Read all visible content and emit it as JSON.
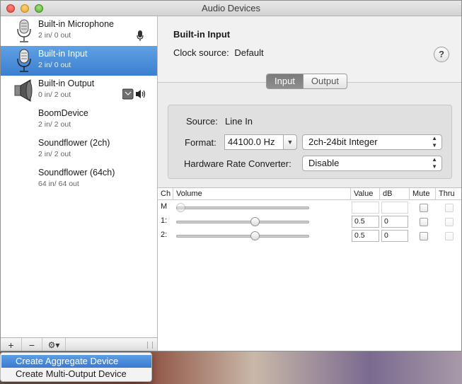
{
  "window": {
    "title": "Audio Devices"
  },
  "sidebar": {
    "devices": [
      {
        "name": "Built-in Microphone",
        "io": "2 in/ 0 out",
        "icon": "microphone-icon",
        "badge": "microphone-small-icon",
        "selected": false
      },
      {
        "name": "Built-in Input",
        "io": "2 in/ 0 out",
        "icon": "microphone-icon",
        "selected": true
      },
      {
        "name": "Built-in Output",
        "io": "0 in/ 2 out",
        "icon": "speaker-icon",
        "badge": "finder-speaker-icon",
        "selected": false
      },
      {
        "name": "BoomDevice",
        "io": "2 in/ 2 out",
        "selected": false
      },
      {
        "name": "Soundflower (2ch)",
        "io": "2 in/ 2 out",
        "selected": false
      },
      {
        "name": "Soundflower (64ch)",
        "io": "64 in/ 64 out",
        "selected": false
      }
    ],
    "add_label": "+",
    "remove_label": "−",
    "gear_label": "⚙▾"
  },
  "main": {
    "device_title": "Built-in Input",
    "clock_label": "Clock source:",
    "clock_value": "Default",
    "help_label": "?",
    "tabs": [
      {
        "label": "Input",
        "active": true
      },
      {
        "label": "Output",
        "active": false
      }
    ],
    "source_label": "Source:",
    "source_value": "Line In",
    "format_label": "Format:",
    "format_rate": "44100.0 Hz",
    "format_bits": "2ch-24bit Integer",
    "hrc_label": "Hardware Rate Converter:",
    "hrc_value": "Disable"
  },
  "table": {
    "headers": [
      "Ch",
      "Volume",
      "Value",
      "dB",
      "Mute",
      "Thru"
    ],
    "rows": [
      {
        "ch": "M",
        "volume": 0,
        "value": "",
        "db": "",
        "enabled": false
      },
      {
        "ch": "1:",
        "volume": 0.6,
        "value": "0.5",
        "db": "0",
        "enabled": true
      },
      {
        "ch": "2:",
        "volume": 0.6,
        "value": "0.5",
        "db": "0",
        "enabled": true
      }
    ]
  },
  "menu": {
    "items": [
      {
        "label": "Create Aggregate Device",
        "highlighted": true
      },
      {
        "label": "Create Multi-Output Device",
        "highlighted": false
      }
    ]
  }
}
